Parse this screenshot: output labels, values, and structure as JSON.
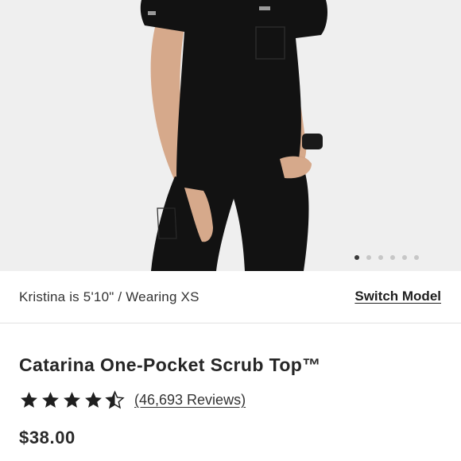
{
  "gallery": {
    "slide_count": 6,
    "active_slide": 1
  },
  "model_bar": {
    "model_info": "Kristina is 5'10\" / Wearing XS",
    "switch_label": "Switch Model"
  },
  "product": {
    "title": "Catarina One-Pocket Scrub Top™",
    "rating_value": 4.5,
    "rating_max": 5,
    "reviews_label": "(46,693 Reviews)",
    "price": "$38.00"
  },
  "colors": {
    "hero_background": "#efefef",
    "garment": "#121212",
    "skin": "#d6a98b",
    "text": "#1f1f1f"
  }
}
